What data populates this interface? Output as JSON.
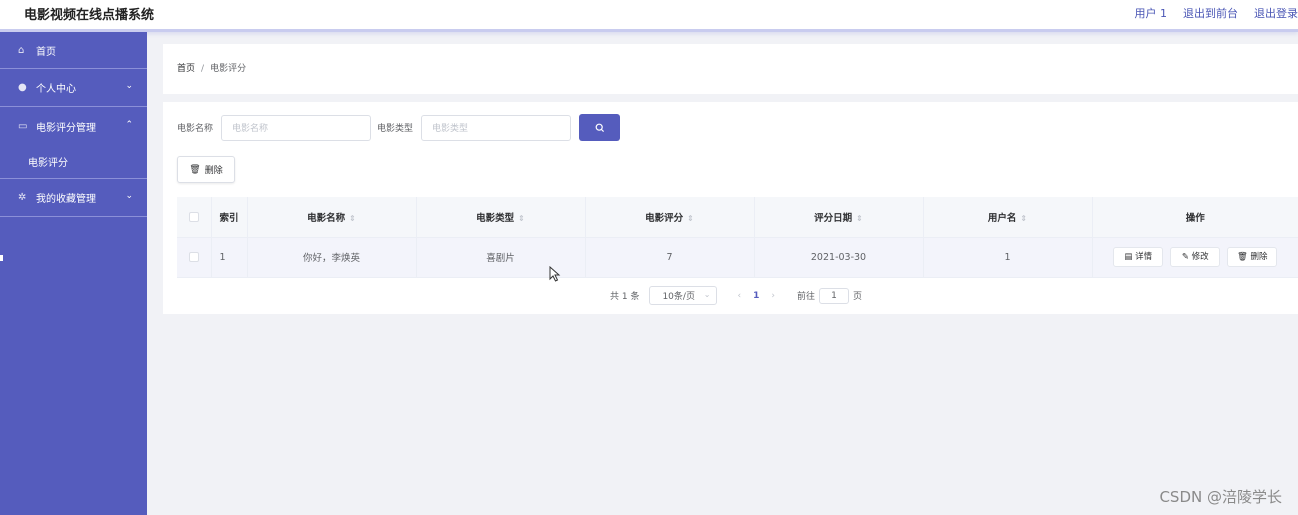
{
  "header": {
    "title": "电影视频在线点播系统",
    "user": "用户 1",
    "back_front": "退出到前台",
    "logout": "退出登录"
  },
  "sidebar": {
    "items": [
      {
        "label": "首页",
        "icon": "home-icon"
      },
      {
        "label": "个人中心",
        "icon": "user-icon"
      },
      {
        "label": "电影评分管理",
        "icon": "message-icon"
      },
      {
        "label": "电影评分",
        "sub": true
      },
      {
        "label": "我的收藏管理",
        "icon": "star-icon"
      }
    ]
  },
  "breadcrumb": {
    "home": "首页",
    "sep": "/",
    "current": "电影评分"
  },
  "search": {
    "name_label": "电影名称",
    "name_placeholder": "电影名称",
    "type_label": "电影类型",
    "type_placeholder": "电影类型"
  },
  "toolbar": {
    "delete_label": "删除"
  },
  "table": {
    "headers": [
      "索引",
      "电影名称",
      "电影类型",
      "电影评分",
      "评分日期",
      "用户名",
      "操作"
    ],
    "rows": [
      {
        "index": "1",
        "name": "你好，李焕英",
        "type": "喜剧片",
        "score": "7",
        "date": "2021-03-30",
        "user": "1"
      }
    ],
    "actions": {
      "detail": "详情",
      "edit": "修改",
      "delete": "删除"
    }
  },
  "pagination": {
    "total": "共 1 条",
    "page_size": "10条/页",
    "current_page": "1",
    "goto_label": "前往",
    "goto_value": "1",
    "page_unit": "页"
  },
  "watermark": "CSDN @涪陵学长",
  "colors": {
    "accent": "#555cbd",
    "sidebar_bg": "#555cbd",
    "page_bg": "#f1f2f6"
  }
}
